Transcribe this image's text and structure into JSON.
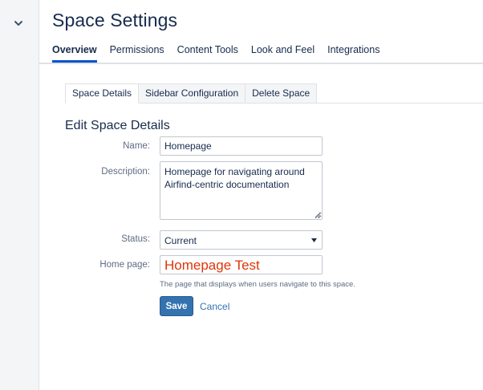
{
  "sidebar": {
    "toggle_icon": "chevron-down-icon"
  },
  "header": {
    "title": "Space Settings"
  },
  "nav": {
    "items": [
      {
        "label": "Overview",
        "active": true
      },
      {
        "label": "Permissions",
        "active": false
      },
      {
        "label": "Content Tools",
        "active": false
      },
      {
        "label": "Look and Feel",
        "active": false
      },
      {
        "label": "Integrations",
        "active": false
      }
    ]
  },
  "subtabs": {
    "items": [
      {
        "label": "Space Details",
        "active": true
      },
      {
        "label": "Sidebar Configuration",
        "active": false
      },
      {
        "label": "Delete Space",
        "active": false
      }
    ]
  },
  "form": {
    "heading": "Edit Space Details",
    "name": {
      "label": "Name:",
      "value": "Homepage"
    },
    "description": {
      "label": "Description:",
      "value": "Homepage for navigating around Airfind-centric documentation"
    },
    "status": {
      "label": "Status:",
      "value": "Current"
    },
    "home_page": {
      "label": "Home page:",
      "value": "Homepage Test",
      "help": "The page that displays when users navigate to this space."
    },
    "save_label": "Save",
    "cancel_label": "Cancel"
  },
  "colors": {
    "accent": "#0052cc",
    "button": "#3572b0",
    "homepage_text": "#de350b"
  }
}
